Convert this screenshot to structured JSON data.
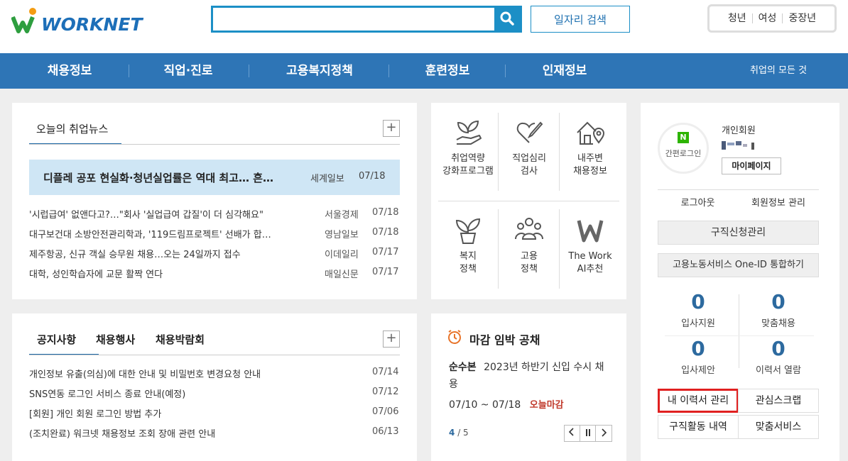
{
  "header": {
    "logo_text": "WORKNET",
    "search_placeholder": "",
    "job_search_label": "일자리 검색",
    "target_groups": [
      "청년",
      "여성",
      "중장년"
    ]
  },
  "nav": {
    "items": [
      "채용정보",
      "직업·진로",
      "고용복지정책",
      "훈련정보",
      "인재정보"
    ],
    "all_label": "취업의 모든 것"
  },
  "news": {
    "tab": "오늘의 취업뉴스",
    "plus": "+",
    "highlight": {
      "title": "디플레 공포 현실화·청년실업률은 역대 최고… 흔…",
      "source": "세계일보",
      "date": "07/18"
    },
    "items": [
      {
        "title": "'시럽급여' 없앤다고?…\"회사 '실업급여 갑질'이 더 심각해요\"",
        "source": "서울경제",
        "date": "07/18"
      },
      {
        "title": "대구보건대 소방안전관리학과, '119드림프로젝트' 선배가 합…",
        "source": "영남일보",
        "date": "07/18"
      },
      {
        "title": "제주항공, 신규 객실 승무원 채용…오는 24일까지 접수",
        "source": "이데일리",
        "date": "07/17"
      },
      {
        "title": "대학, 성인학습자에 교문 활짝 연다",
        "source": "매일신문",
        "date": "07/17"
      }
    ]
  },
  "notice": {
    "tabs": [
      "공지사항",
      "채용행사",
      "채용박람회"
    ],
    "plus": "+",
    "items": [
      {
        "title": "개인정보 유출(의심)에 대한 안내 및 비밀번호 변경요청 안내",
        "date": "07/14"
      },
      {
        "title": "SNS연동 로그인 서비스 종료 안내(예정)",
        "date": "07/12"
      },
      {
        "title": "[회원] 개인 회원 로그인 방법 추가",
        "date": "07/06"
      },
      {
        "title": "(조치완료) 워크넷 채용정보 조회 장애 관련 안내",
        "date": "06/13"
      }
    ]
  },
  "services": {
    "items": [
      {
        "line1": "취업역량",
        "line2": "강화프로그램",
        "icon": "sprout-hand-icon"
      },
      {
        "line1": "직업심리",
        "line2": "검사",
        "icon": "heart-pen-icon"
      },
      {
        "line1": "내주변",
        "line2": "채용정보",
        "icon": "house-location-icon"
      },
      {
        "line1": "복지",
        "line2": "정책",
        "icon": "plant-pot-icon"
      },
      {
        "line1": "고용",
        "line2": "정책",
        "icon": "people-group-icon"
      },
      {
        "line1": "The Work",
        "line2": "AI추천",
        "icon": "w-letter-icon"
      }
    ]
  },
  "deadline": {
    "title": "마감 임박 공채",
    "company": "순수본",
    "job": "2023년 하반기 신입 수시 채용",
    "job_line1": "2023년 하반기 신입 수시 채",
    "job_line2": "용",
    "period": "07/10 ~ 07/18",
    "tag": "오늘마감",
    "page_current": "4",
    "page_total": "/ 5",
    "colors": {
      "accent": "#e8742a",
      "tag": "#c0392b"
    }
  },
  "user": {
    "login_type_badge": "N",
    "login_type_label": "간편로그인",
    "member_type": "개인회원",
    "mypage_label": "마이페이지",
    "logout_label": "로그아웃",
    "member_info_label": "회원정보 관리",
    "job_request_label": "구직신청관리",
    "one_id_label": "고용노동서비스 One-ID 통합하기",
    "counts": [
      {
        "value": "0",
        "label": "입사지원"
      },
      {
        "value": "0",
        "label": "맞춤채용"
      },
      {
        "value": "0",
        "label": "입사제안"
      },
      {
        "value": "0",
        "label": "이력서 열람"
      }
    ],
    "links": [
      "내 이력서 관리",
      "관심스크랩",
      "구직활동 내역",
      "맞춤서비스"
    ]
  }
}
